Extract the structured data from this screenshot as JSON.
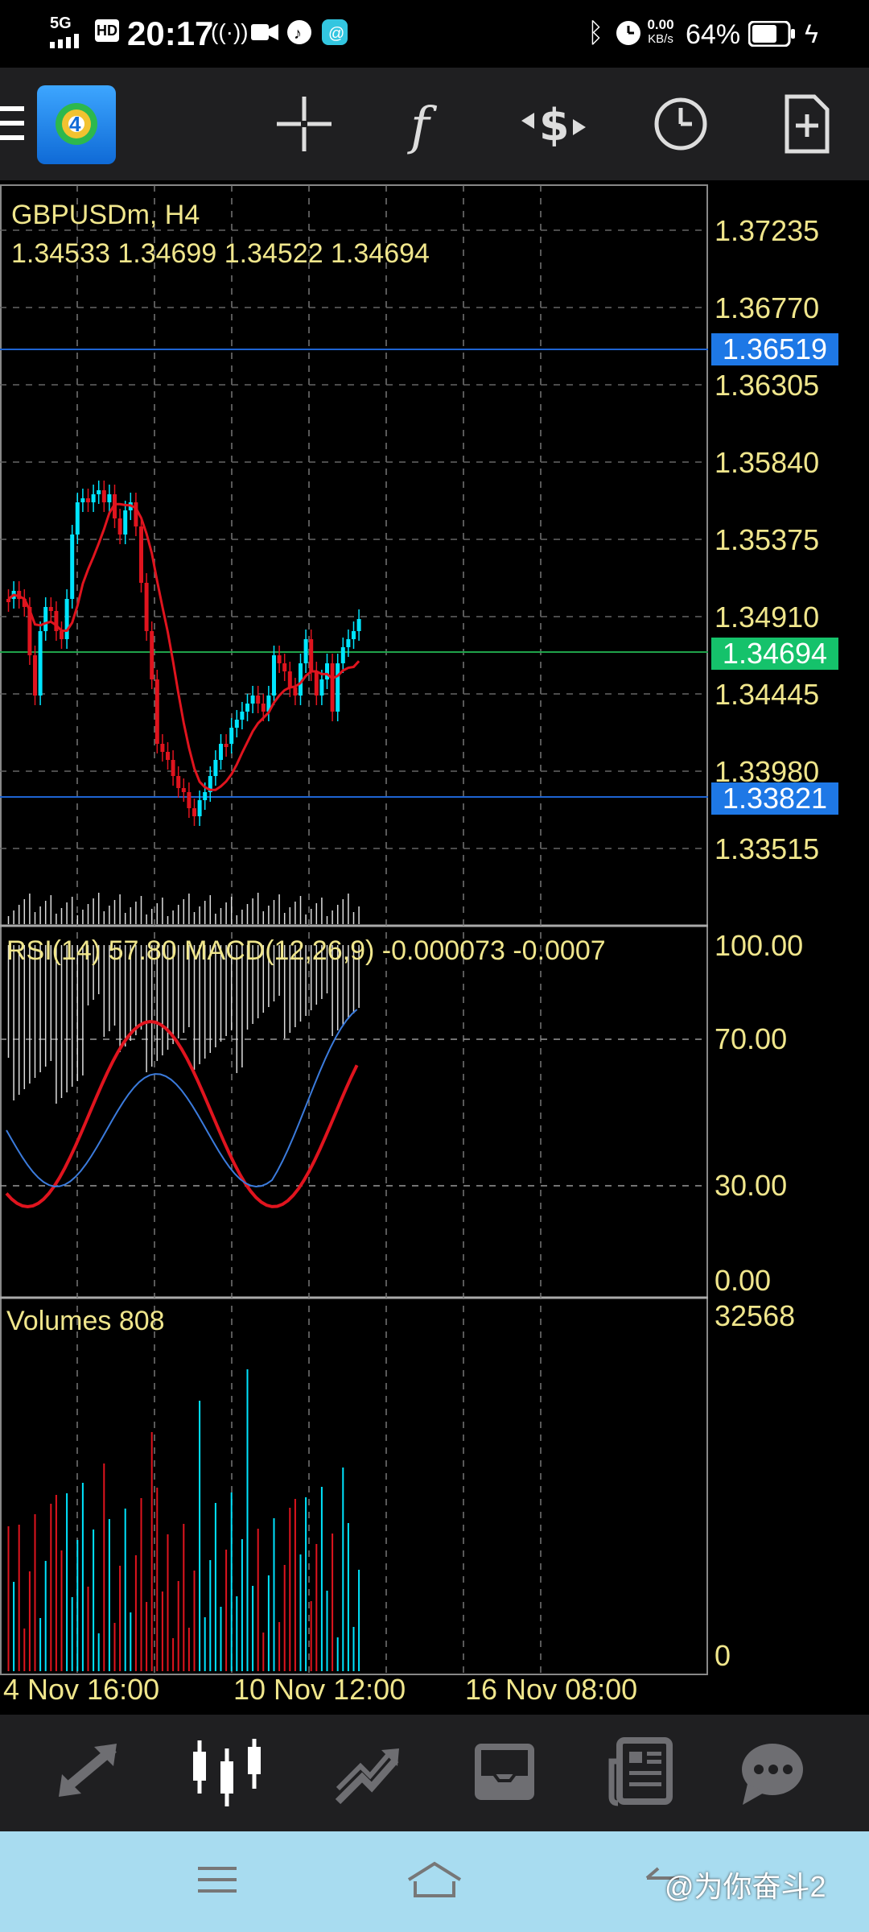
{
  "status_bar": {
    "network": "5G",
    "hd_badge": "HD",
    "time": "20:17",
    "speed_value": "0.00",
    "speed_unit": "KB/s",
    "battery": "64%"
  },
  "chart": {
    "symbol_timeframe": "GBPUSDm, H4",
    "ohlc": "1.34533 1.34699 1.34522 1.34694",
    "price_axis": [
      "1.37235",
      "1.36770",
      "1.36305",
      "1.35840",
      "1.35375",
      "1.34910",
      "1.34445",
      "1.33980",
      "1.33515"
    ],
    "tags": {
      "upper_line": "1.36519",
      "bid": "1.34694",
      "lower_line": "1.33821"
    },
    "oscillator_title": "RSI(14) 57.80 MACD(12,26,9) -0.000073 -0.0007",
    "oscillator_axis": [
      "100.00",
      "70.00",
      "30.00",
      "0.00"
    ],
    "volumes_title": "Volumes 808",
    "volume_axis": [
      "32568",
      "0"
    ],
    "time_axis": [
      "4 Nov 16:00",
      "10 Nov 12:00",
      "16 Nov 08:00"
    ]
  },
  "colors": {
    "bull": "#00e5ff",
    "bear": "#e0141e",
    "ma_line": "#e0141e",
    "hline_blue": "#1e64d2",
    "hline_green": "#1fa34a",
    "axis_text": "#f0e68c",
    "bid_tag": "#15c26b",
    "line_tag": "#1e78e6"
  },
  "icons": {
    "menu": "menu-icon",
    "app_logo": "metatrader-logo",
    "crosshair": "crosshair-icon",
    "indicators": "function-icon",
    "symbols": "dollar-arrows-icon",
    "timeframe": "clock-icon",
    "new_order": "new-order-icon"
  },
  "watermark": "@为你奋斗2"
}
